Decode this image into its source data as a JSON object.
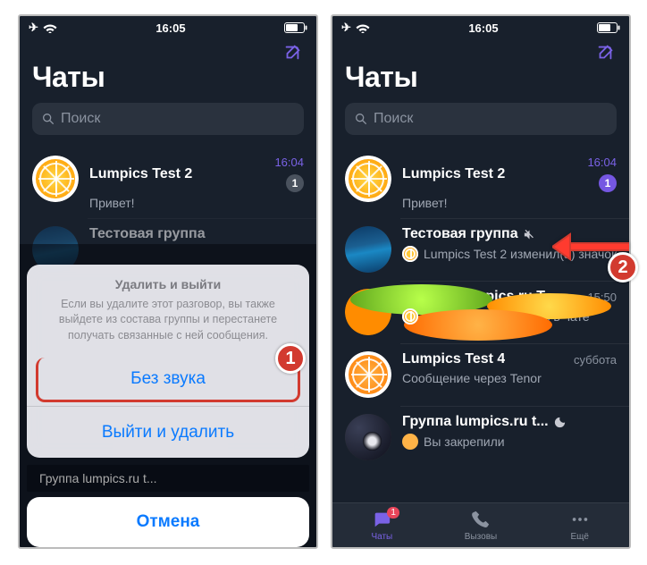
{
  "status": {
    "time": "16:05"
  },
  "header": {
    "title": "Чаты"
  },
  "search": {
    "placeholder": "Поиск"
  },
  "chats": [
    {
      "title": "Lumpics Test 2",
      "subtitle": "Привет!",
      "time": "16:04",
      "unread": "1"
    },
    {
      "title": "Тестовая группа",
      "subtitle": "Lumpics Test 2 изменил(а) значок гр...",
      "time": ""
    },
    {
      "title": "Группа Lumpics.ru T...",
      "subtitle": "Lumpics Test 2 теперь в чате",
      "time": "15:50"
    },
    {
      "title": "Lumpics Test 4",
      "subtitle": "Сообщение через Tenor",
      "time": "суббота"
    },
    {
      "title": "Группа lumpics.ru t...",
      "subtitle": "Вы закрепили",
      "time": ""
    }
  ],
  "chat2_left": "Тестовая группа",
  "sheet": {
    "title": "Удалить и выйти",
    "message": "Если вы удалите этот разговор, вы также выйдете из состава группы и перестанете получать связанные с ней сообщения.",
    "mute": "Без звука",
    "leave": "Выйти и удалить",
    "cancel": "Отмена"
  },
  "left_peek": "Группа lumpics.ru t...",
  "tabs": {
    "chats": "Чаты",
    "calls": "Вызовы",
    "more": "Ещё",
    "badge": "1"
  },
  "steps": {
    "one": "1",
    "two": "2"
  }
}
